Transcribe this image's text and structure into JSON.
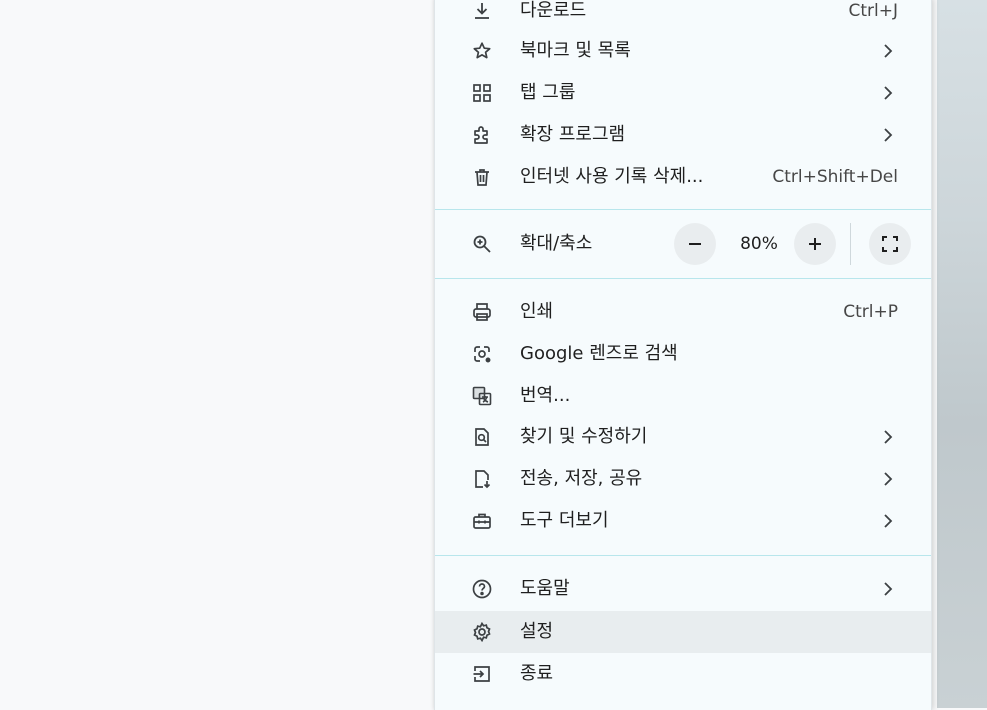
{
  "menu": {
    "items_top": [
      {
        "label": "다운로드",
        "shortcut": "Ctrl+J",
        "icon": "download-icon"
      },
      {
        "label": "북마크 및 목록",
        "shortcut": "",
        "icon": "star-icon",
        "submenu": true
      },
      {
        "label": "탭 그룹",
        "shortcut": "",
        "icon": "tab-groups-icon",
        "submenu": true
      },
      {
        "label": "확장 프로그램",
        "shortcut": "",
        "icon": "puzzle-icon",
        "submenu": true
      },
      {
        "label": "인터넷 사용 기록 삭제...",
        "shortcut": "Ctrl+Shift+Del",
        "icon": "trash-icon"
      }
    ],
    "zoom": {
      "label": "확대/축소",
      "value": "80%",
      "icon": "zoom-icon"
    },
    "items_middle": [
      {
        "label": "인쇄",
        "shortcut": "Ctrl+P",
        "icon": "print-icon"
      },
      {
        "label": "Google 렌즈로 검색",
        "shortcut": "",
        "icon": "lens-icon"
      },
      {
        "label": "번역...",
        "shortcut": "",
        "icon": "translate-icon"
      },
      {
        "label": "찾기 및 수정하기",
        "shortcut": "",
        "icon": "find-icon",
        "submenu": true
      },
      {
        "label": "전송, 저장, 공유",
        "shortcut": "",
        "icon": "save-share-icon",
        "submenu": true
      },
      {
        "label": "도구 더보기",
        "shortcut": "",
        "icon": "toolbox-icon",
        "submenu": true
      }
    ],
    "items_bottom": [
      {
        "label": "도움말",
        "shortcut": "",
        "icon": "help-icon",
        "submenu": true
      },
      {
        "label": "설정",
        "shortcut": "",
        "icon": "gear-icon",
        "highlighted": true
      },
      {
        "label": "종료",
        "shortcut": "",
        "icon": "exit-icon"
      }
    ]
  },
  "colors": {
    "menu_bg": "#f6fbfd",
    "separator": "#b8e6ec",
    "hover": "#e8edef",
    "text": "#1f1f1f"
  }
}
